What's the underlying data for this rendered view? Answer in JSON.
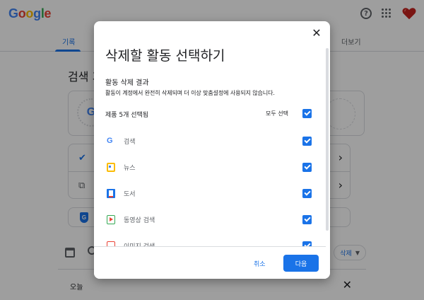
{
  "header": {
    "logo_letters": [
      {
        "char": "G",
        "color": "#4285f4"
      },
      {
        "char": "o",
        "color": "#ea4335"
      },
      {
        "char": "o",
        "color": "#fbbc04"
      },
      {
        "char": "g",
        "color": "#4285f4"
      },
      {
        "char": "l",
        "color": "#34a853"
      },
      {
        "char": "e",
        "color": "#ea4335"
      }
    ],
    "help_glyph": "?"
  },
  "tabs": {
    "active": "기록",
    "more": "더보기"
  },
  "background": {
    "heading": "검색 기",
    "today_label": "오늘",
    "delete_chip": "삭제",
    "today_close": "✕"
  },
  "dialog": {
    "title": "삭제할 활동 선택하기",
    "subtitle": "활동 삭제 결과",
    "description": "활동이 계정에서 완전히 삭제되며 더 이상 맞춤설정에 사용되지 않습니다.",
    "products_count": "제품 5개 선택됨",
    "select_all_label": "모두 선택",
    "select_all_checked": true,
    "items": [
      {
        "label": "검색",
        "icon": "google-g-icon",
        "checked": true
      },
      {
        "label": "뉴스",
        "icon": "news-icon",
        "checked": true
      },
      {
        "label": "도서",
        "icon": "books-icon",
        "checked": true
      },
      {
        "label": "동영상 검색",
        "icon": "video-icon",
        "checked": true
      },
      {
        "label": "이미지 검색",
        "icon": "image-icon",
        "checked": true
      }
    ],
    "cancel_label": "취소",
    "next_label": "다음",
    "close_glyph": "✕"
  },
  "colors": {
    "accent": "#1a73e8",
    "scrim": "rgba(0,0,0,0.38)",
    "avatar_heart": "#c5221f"
  }
}
